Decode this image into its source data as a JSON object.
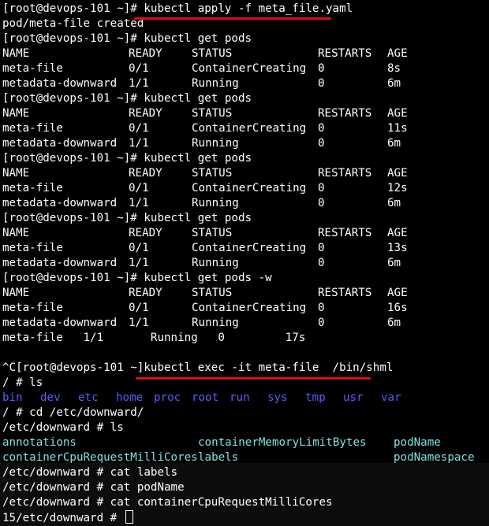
{
  "colors": {
    "background": "#000000",
    "text": "#ffffff",
    "cyan": "#7fe0e0",
    "blue": "#5a5aff",
    "highlight": "#e01010"
  },
  "lines": [
    {
      "text": "[root@devops-101 ~]# kubectl apply -f meta_file.yaml"
    },
    {
      "text": "pod/meta-file created"
    },
    {
      "text": "[root@devops-101 ~]# kubectl get pods"
    },
    {
      "cells": [
        "NAME",
        "READY",
        "STATUS",
        "RESTARTS",
        "AGE"
      ]
    },
    {
      "cells": [
        "meta-file",
        "0/1",
        "ContainerCreating",
        "0",
        "8s"
      ]
    },
    {
      "cells": [
        "metadata-downward",
        "1/1",
        "Running",
        "0",
        "6m"
      ]
    },
    {
      "text": "[root@devops-101 ~]# kubectl get pods"
    },
    {
      "cells": [
        "NAME",
        "READY",
        "STATUS",
        "RESTARTS",
        "AGE"
      ]
    },
    {
      "cells": [
        "meta-file",
        "0/1",
        "ContainerCreating",
        "0",
        "11s"
      ]
    },
    {
      "cells": [
        "metadata-downward",
        "1/1",
        "Running",
        "0",
        "6m"
      ]
    },
    {
      "text": "[root@devops-101 ~]# kubectl get pods"
    },
    {
      "cells": [
        "NAME",
        "READY",
        "STATUS",
        "RESTARTS",
        "AGE"
      ]
    },
    {
      "cells": [
        "meta-file",
        "0/1",
        "ContainerCreating",
        "0",
        "12s"
      ]
    },
    {
      "cells": [
        "metadata-downward",
        "1/1",
        "Running",
        "0",
        "6m"
      ]
    },
    {
      "text": "[root@devops-101 ~]# kubectl get pods"
    },
    {
      "cells": [
        "NAME",
        "READY",
        "STATUS",
        "RESTARTS",
        "AGE"
      ]
    },
    {
      "cells": [
        "meta-file",
        "0/1",
        "ContainerCreating",
        "0",
        "13s"
      ]
    },
    {
      "cells": [
        "metadata-downward",
        "1/1",
        "Running",
        "0",
        "6m"
      ]
    },
    {
      "text": "[root@devops-101 ~]# kubectl get pods -w"
    },
    {
      "cells": [
        "NAME",
        "READY",
        "STATUS",
        "RESTARTS",
        "AGE"
      ]
    },
    {
      "cells": [
        "meta-file",
        "0/1",
        "ContainerCreating",
        "0",
        "16s"
      ]
    },
    {
      "cells": [
        "metadata-downward",
        "1/1",
        "Running",
        "0",
        "6m"
      ]
    },
    {
      "text": "meta-file   1/1       Running   0         17s"
    },
    {
      "text": ""
    },
    {
      "text": "^C[root@devops-101 ~]kubectl exec -it meta-file  /bin/shml"
    },
    {
      "text": "/ # ls"
    },
    {
      "dirs": [
        "bin",
        "dev",
        "etc",
        "home",
        "proc",
        "root",
        "run",
        "sys",
        "tmp",
        "usr",
        "var"
      ]
    },
    {
      "text": "/ # cd /etc/downward/"
    },
    {
      "text": "/etc/downward # ls"
    },
    {
      "cyancells": [
        "annotations",
        "containerMemoryLimitBytes",
        "podName"
      ]
    },
    {
      "cyancells": [
        "containerCpuRequestMilliCores",
        "labels",
        "podNamespace"
      ]
    },
    {
      "text": "/etc/downward # cat labels"
    },
    {
      "text": "/etc/downward # cat podName"
    },
    {
      "text": "/etc/downward # cat containerCpuRequestMilliCores"
    },
    {
      "text": "15/etc/downward # ",
      "cursor": true
    }
  ]
}
